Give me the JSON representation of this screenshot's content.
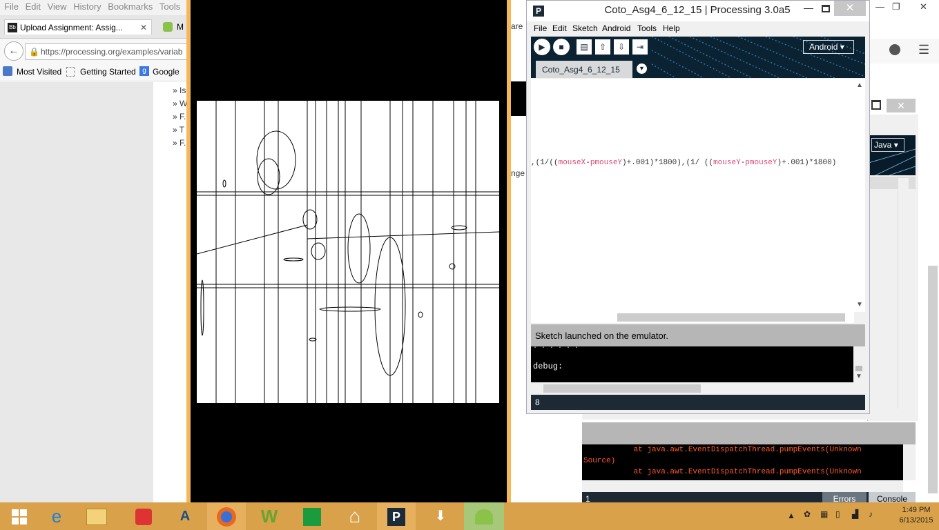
{
  "firefox": {
    "menu": [
      "File",
      "Edit",
      "View",
      "History",
      "Bookmarks",
      "Tools"
    ],
    "tabs": [
      {
        "label": "Upload Assignment: Assig..."
      },
      {
        "label": "M"
      }
    ],
    "url": "https://processing.org/examples/variab",
    "bookmarks": [
      "Most Visited",
      "Getting Started",
      "Google"
    ],
    "side_list": [
      "» Is",
      "» W",
      "» F.",
      "» T",
      "» F."
    ],
    "bg_tab_fragment": "are v",
    "bg_text_fragment": "nge"
  },
  "processing_main": {
    "title": "Coto_Asg4_6_12_15 | Processing 3.0a5",
    "menu": [
      "File",
      "Edit",
      "Sketch",
      "Android",
      "Tools",
      "Help"
    ],
    "toolbar": {
      "run": "▶",
      "stop": "■",
      "new": "new",
      "open": "open",
      "save": "save",
      "export": "export"
    },
    "mode": "Android",
    "tab_name": "Coto_Asg4_6_12_15",
    "code": {
      "p1": ",(1/((",
      "k1": "mouseX",
      "p2": "-",
      "k2": "pmouseY",
      "p3": ")+.001)*1800),(1/ ((",
      "k3": "mouseY",
      "p4": "-",
      "k4": "pmouseY",
      "p5": ")+.001)*1800)"
    },
    "status": "Sketch launched on the emulator.",
    "console_lines": [
      "debug:"
    ],
    "line_number": "8"
  },
  "processing_second": {
    "mode": "Java",
    "console_lines": [
      "           at java.awt.EventDispatchThread.pumpEvents(Unknown",
      "Source)",
      "           at java.awt.EventDispatchThread.pumpEvents(Unknown"
    ],
    "line_number": "1",
    "errors_tab": "Errors",
    "console_tab": "Console"
  },
  "taskbar": {
    "clock_time": "1:49 PM",
    "clock_date": "6/13/2015",
    "colors": {
      "bar": "#d9a14a",
      "active": "#a7c779"
    }
  }
}
